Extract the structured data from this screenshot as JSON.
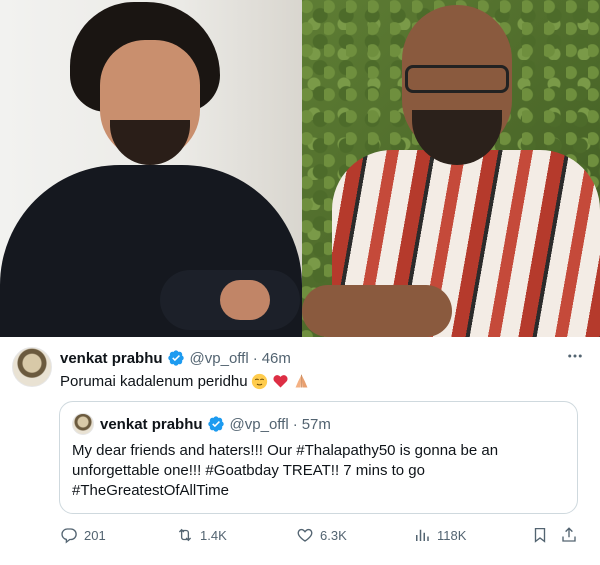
{
  "tweet": {
    "author_name": "venkat prabhu",
    "handle": "@vp_offl",
    "separator": "·",
    "time": "46m",
    "text": "Porumai kadalenum peridhu",
    "emojis": [
      "relieved-face-emoji",
      "red-heart-emoji",
      "folded-hands-emoji"
    ]
  },
  "quote": {
    "author_name": "venkat prabhu",
    "handle": "@vp_offl",
    "separator": "·",
    "time": "57m",
    "text": "My dear friends and haters!!! Our #Thalapathy50 is gonna be an unforgettable one!!! #Goatbday TREAT!! 7 mins to go #TheGreatestOfAllTime"
  },
  "actions": {
    "replies": "201",
    "reposts": "1.4K",
    "likes": "6.3K",
    "views": "118K"
  },
  "colors": {
    "verified": "#1d9bf0",
    "muted": "#536471",
    "text": "#0f1419",
    "border": "#cfd9de"
  }
}
